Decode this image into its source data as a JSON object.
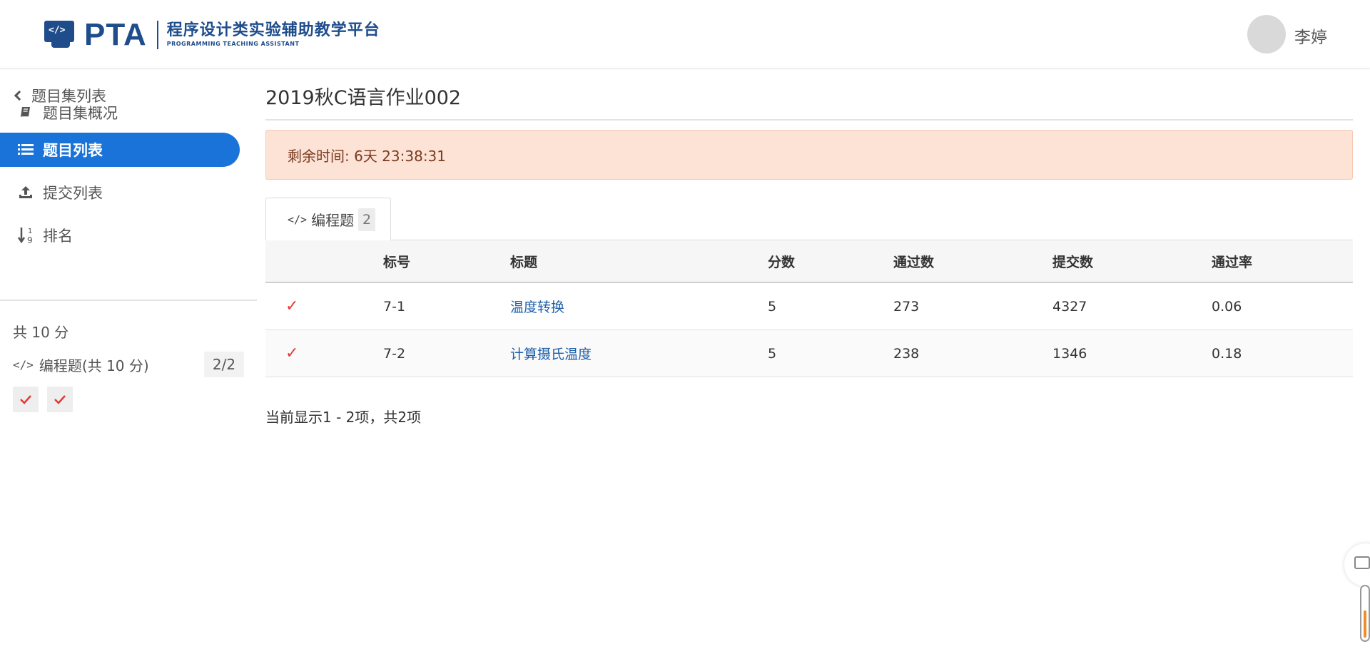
{
  "header": {
    "logo_text": "PTA",
    "logo_icon_text": "</>",
    "platform_name": "程序设计类实验辅助教学平台",
    "platform_name_en": "PROGRAMMING TEACHING ASSISTANT",
    "user_name": "李婷"
  },
  "sidebar": {
    "back_label": "题目集列表",
    "items": [
      {
        "label": "题目集概况",
        "icon": "book-icon",
        "active": false
      },
      {
        "label": "题目列表",
        "icon": "list-icon",
        "active": true
      },
      {
        "label": "提交列表",
        "icon": "upload-icon",
        "active": false
      },
      {
        "label": "排名",
        "icon": "sort-numeric-icon",
        "active": false
      }
    ],
    "total_score": "共 10 分",
    "group_label": "编程题(共 10 分)",
    "group_progress": "2/2",
    "problem_status": [
      "accepted",
      "accepted"
    ]
  },
  "main": {
    "title": "2019秋C语言作业002",
    "alert": "剩余时间: 6天 23:38:31",
    "tab": {
      "label": "编程题",
      "count": "2"
    },
    "table": {
      "headers": [
        "",
        "标号",
        "标题",
        "分数",
        "通过数",
        "提交数",
        "通过率"
      ],
      "rows": [
        {
          "status": "✓",
          "id": "7-1",
          "title": "温度转换",
          "score": "5",
          "passed": "273",
          "submitted": "4327",
          "rate": "0.06"
        },
        {
          "status": "✓",
          "id": "7-2",
          "title": "计算摄氏温度",
          "score": "5",
          "passed": "238",
          "submitted": "1346",
          "rate": "0.18"
        }
      ]
    },
    "footer": "当前显示1 - 2项，共2项"
  },
  "colors": {
    "brand": "#1f4d8c",
    "active": "#1a73d8",
    "alert_bg": "#fde2d6",
    "accepted": "#e53935",
    "link": "#1f5fa8"
  }
}
